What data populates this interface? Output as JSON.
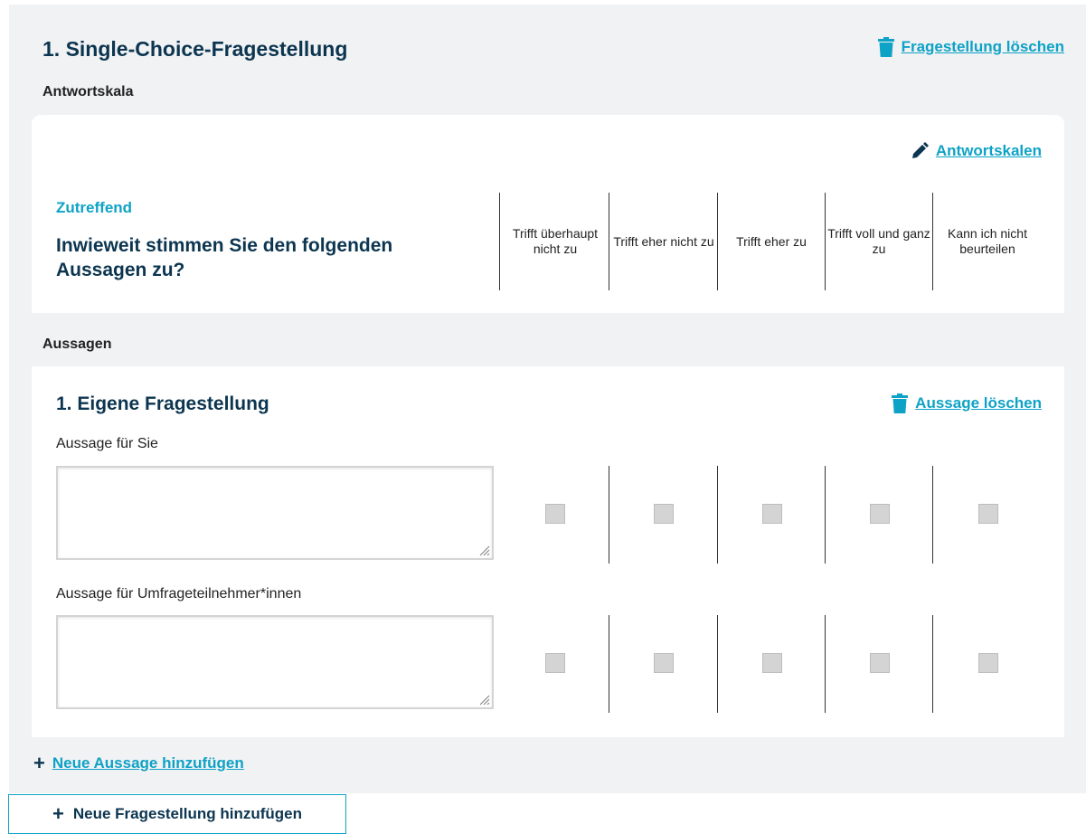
{
  "question": {
    "title": "1. Single-Choice-Fragestellung",
    "delete_label": "Fragestellung löschen"
  },
  "scale": {
    "section_label": "Antwortskala",
    "edit_label": "Antwortskalen",
    "name": "Zutreffend",
    "question_text": "Inwieweit stimmen Sie den folgenden Aussagen zu?",
    "options": [
      "Trifft überhaupt nicht zu",
      "Trifft eher nicht zu",
      "Trifft eher zu",
      "Trifft voll und ganz zu",
      "Kann ich nicht beurteilen"
    ]
  },
  "statements": {
    "section_label": "Aussagen",
    "items": [
      {
        "title": "1. Eigene Fragestellung",
        "delete_label": "Aussage löschen",
        "field_self_label": "Aussage für Sie",
        "field_self_value": "",
        "field_participants_label": "Aussage für Umfrageteilnehmer*innen",
        "field_participants_value": ""
      }
    ],
    "add_label": "Neue Aussage hinzufügen"
  },
  "add_question_label": "Neue Fragestellung hinzufügen",
  "colors": {
    "accent": "#0ea2c6",
    "heading": "#0c3550",
    "background": "#f1f2f4"
  }
}
